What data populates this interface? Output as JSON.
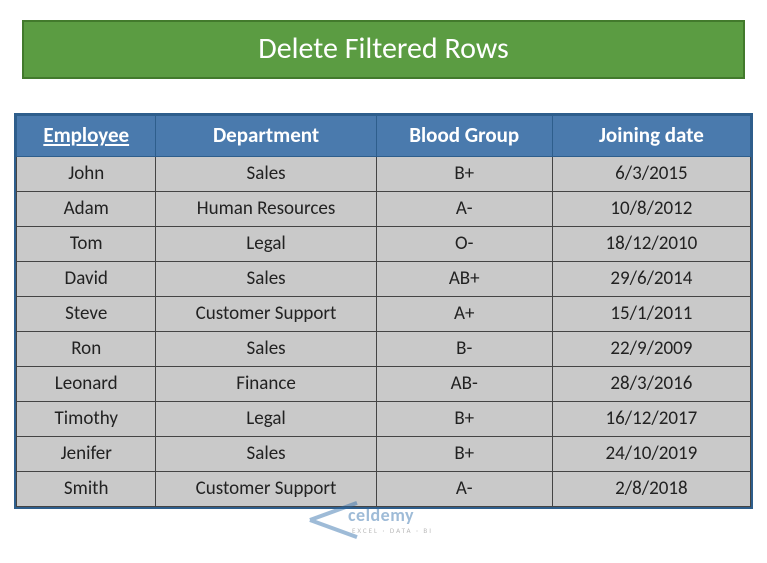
{
  "title": "Delete Filtered Rows",
  "headers": {
    "employee": "Employee",
    "department": "Department",
    "blood_group": "Blood Group",
    "joining_date": "Joining date"
  },
  "rows": [
    {
      "employee": "John",
      "department": "Sales",
      "blood_group": "B+",
      "joining_date": "6/3/2015"
    },
    {
      "employee": "Adam",
      "department": "Human Resources",
      "blood_group": "A-",
      "joining_date": "10/8/2012"
    },
    {
      "employee": "Tom",
      "department": "Legal",
      "blood_group": "O-",
      "joining_date": "18/12/2010"
    },
    {
      "employee": "David",
      "department": "Sales",
      "blood_group": "AB+",
      "joining_date": "29/6/2014"
    },
    {
      "employee": "Steve",
      "department": "Customer Support",
      "blood_group": "A+",
      "joining_date": "15/1/2011"
    },
    {
      "employee": "Ron",
      "department": "Sales",
      "blood_group": "B-",
      "joining_date": "22/9/2009"
    },
    {
      "employee": "Leonard",
      "department": "Finance",
      "blood_group": "AB-",
      "joining_date": "28/3/2016"
    },
    {
      "employee": "Timothy",
      "department": "Legal",
      "blood_group": "B+",
      "joining_date": "16/12/2017"
    },
    {
      "employee": "Jenifer",
      "department": "Sales",
      "blood_group": "B+",
      "joining_date": "24/10/2019"
    },
    {
      "employee": "Smith",
      "department": "Customer Support",
      "blood_group": "A-",
      "joining_date": "2/8/2018"
    }
  ],
  "watermark": {
    "brand": "celdemy",
    "tagline": "EXCEL · DATA · BI"
  }
}
